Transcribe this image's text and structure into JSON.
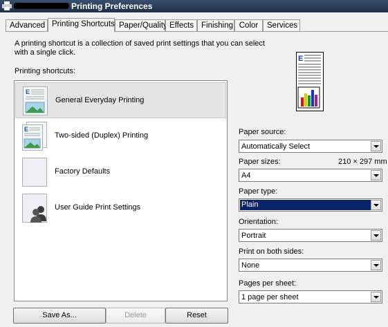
{
  "window": {
    "title": "Printing Preferences"
  },
  "tabs": [
    {
      "label": "Advanced"
    },
    {
      "label": "Printing Shortcuts",
      "active": true
    },
    {
      "label": "Paper/Quality"
    },
    {
      "label": "Effects"
    },
    {
      "label": "Finishing"
    },
    {
      "label": "Color"
    },
    {
      "label": "Services"
    }
  ],
  "shortcuts": {
    "description": "A printing shortcut is a collection of saved print settings that you can select with a single click.",
    "list_label": "Printing shortcuts:",
    "items": [
      {
        "label": "General Everyday Printing",
        "selected": true,
        "icon": "general-printing-icon"
      },
      {
        "label": "Two-sided (Duplex) Printing",
        "icon": "duplex-printing-icon"
      },
      {
        "label": "Factory Defaults",
        "icon": "blank-page-icon"
      },
      {
        "label": "User Guide Print Settings",
        "icon": "users-page-icon"
      }
    ],
    "buttons": {
      "save_as": "Save As...",
      "delete": "Delete",
      "reset": "Reset"
    }
  },
  "settings": {
    "paper_source": {
      "label": "Paper source:",
      "value": "Automatically Select"
    },
    "paper_sizes": {
      "label": "Paper sizes:",
      "dimensions": "210 × 297 mm",
      "value": "A4"
    },
    "paper_type": {
      "label": "Paper type:",
      "value": "Plain"
    },
    "orientation": {
      "label": "Orientation:",
      "value": "Portrait"
    },
    "print_both_sides": {
      "label": "Print on both sides:",
      "value": "None"
    },
    "pages_per_sheet": {
      "label": "Pages per sheet:",
      "value": "1 page per sheet"
    }
  },
  "colors": {
    "selection": "#0a246a",
    "titlebar": "#1f2f48"
  }
}
